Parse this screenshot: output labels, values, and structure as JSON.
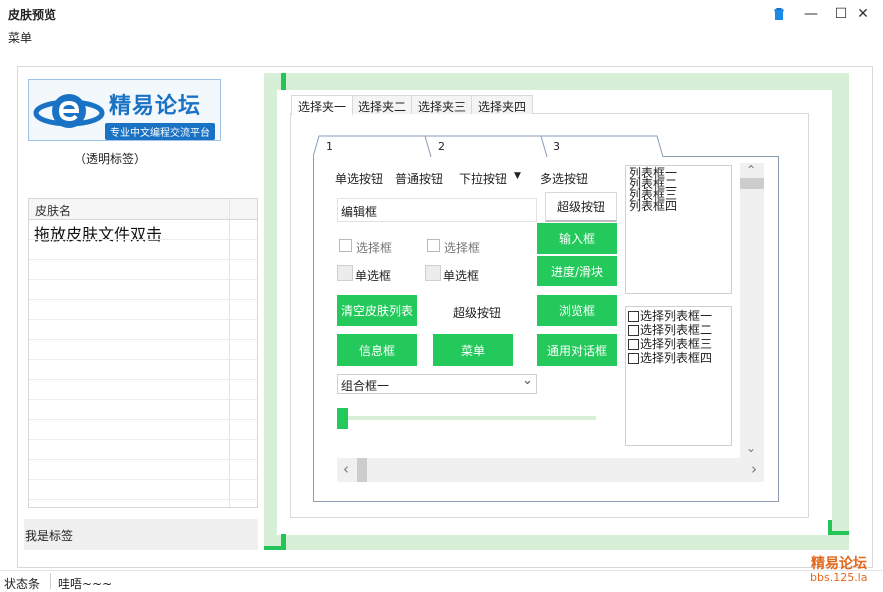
{
  "window": {
    "title": "皮肤预览",
    "menu_label": "菜单",
    "icons": [
      "skin-icon",
      "minimize-icon",
      "maximize-icon",
      "close-icon"
    ],
    "minimize_glyph": "—",
    "maximize_glyph": "☐",
    "close_glyph": "✕"
  },
  "logo": {
    "title": "精易论坛",
    "subtitle": "专业中文编程交流平台"
  },
  "left": {
    "transparent_label": "（透明标签）",
    "skin_list_header": "皮肤名",
    "drag_hint": "拖放皮肤文件双击",
    "me_label": "我是标签"
  },
  "outer_tabs": [
    "选择夹一",
    "选择夹二",
    "选择夹三",
    "选择夹四"
  ],
  "inner_tabs": [
    "1",
    "2",
    "3"
  ],
  "controls": {
    "radio_label": "单选按钮",
    "normal_button": "普通按钮",
    "dropdown_button": "下拉按钮",
    "dropdown_arrow": "▼",
    "multi_select_button": "多选按钮",
    "edit_box": "编辑框",
    "super_button_top": "超级按钮",
    "checkbox_1": "选择框",
    "checkbox_2": "选择框",
    "radio_1": "单选框",
    "radio_2": "单选框",
    "input_box_btn": "输入框",
    "progress_btn": "进度/滑块",
    "clear_skin_btn": "清空皮肤列表",
    "super_button_mid": "超级按钮",
    "browse_btn": "浏览框",
    "info_btn": "信息框",
    "menu_btn": "菜单",
    "common_dialog_btn": "通用对话框",
    "combo_value": "组合框一",
    "combo_arrow": "⌄",
    "slider_value": 0
  },
  "listbox": [
    "列表框一",
    "列表框二",
    "列表框三",
    "列表框四"
  ],
  "check_listbox": [
    "选择列表框一",
    "选择列表框二",
    "选择列表框三",
    "选择列表框四"
  ],
  "scroll": {
    "up": "⌃",
    "down": "⌄",
    "left": "‹",
    "right": "›"
  },
  "status": {
    "label": "状态条",
    "text": "哇唔~~~"
  },
  "watermark": {
    "line1": "精易论坛",
    "line2": "bbs.125.la"
  },
  "colors": {
    "accent_green": "#23c95a",
    "light_green": "#d6efd6",
    "logo_blue": "#1a72c4",
    "watermark_orange": "#e2681d"
  }
}
